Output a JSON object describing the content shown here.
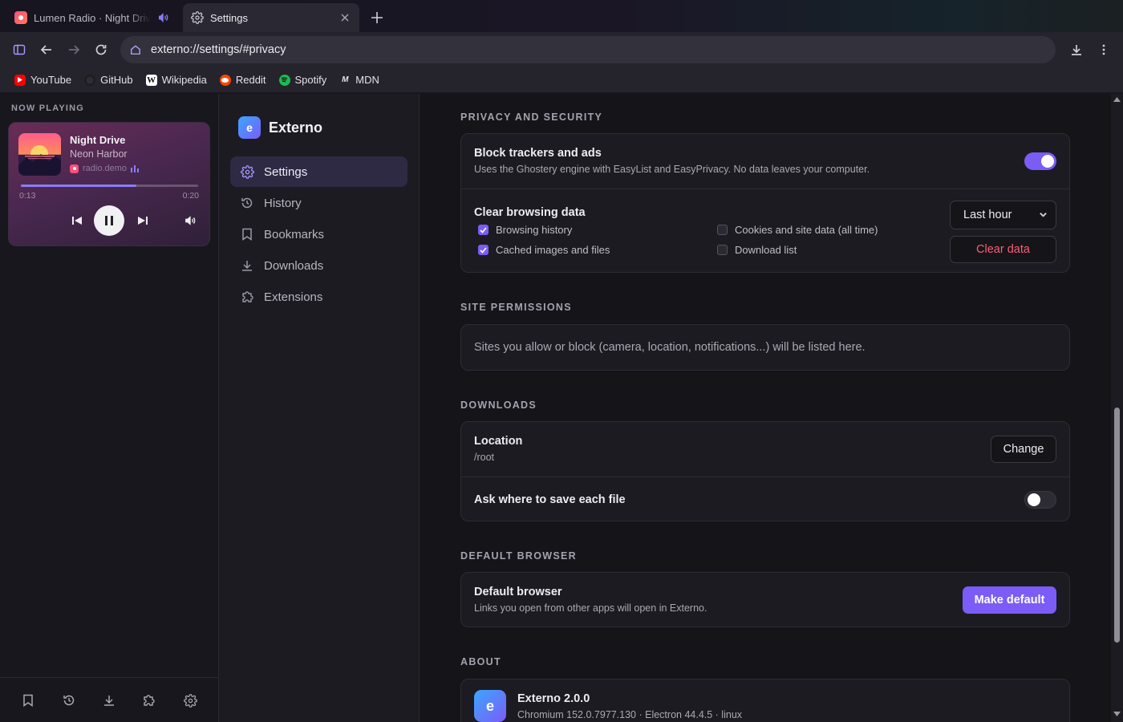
{
  "tabs": [
    {
      "title": "Lumen Radio · Night Drive",
      "audio": true,
      "favicon": "lumen-radio-icon"
    },
    {
      "title": "Settings",
      "active": true,
      "favicon": "gear-icon"
    }
  ],
  "toolbar": {
    "url": "externo://settings/#privacy"
  },
  "bookmarks": [
    {
      "label": "YouTube",
      "icon": "youtube-icon",
      "color": "#ff0000"
    },
    {
      "label": "GitHub",
      "icon": "github-icon",
      "color": "#24292e"
    },
    {
      "label": "Wikipedia",
      "icon": "wikipedia-icon",
      "color": "#ffffff"
    },
    {
      "label": "Reddit",
      "icon": "reddit-icon",
      "color": "#ff4500"
    },
    {
      "label": "Spotify",
      "icon": "spotify-icon",
      "color": "#1db954"
    },
    {
      "label": "MDN",
      "icon": "mdn-icon",
      "color": "#ffffff"
    }
  ],
  "now_playing": {
    "header": "NOW PLAYING",
    "title": "Night Drive",
    "artist": "Neon Harbor",
    "source": "radio.demo",
    "elapsed": "0:13",
    "duration": "0:20",
    "progress": 0.65
  },
  "settings_nav": {
    "brand": "Externo",
    "logo_letter": "e",
    "items": [
      {
        "label": "Settings",
        "icon": "gear-icon",
        "active": true
      },
      {
        "label": "History",
        "icon": "history-icon"
      },
      {
        "label": "Bookmarks",
        "icon": "bookmark-icon"
      },
      {
        "label": "Downloads",
        "icon": "download-icon"
      },
      {
        "label": "Extensions",
        "icon": "puzzle-icon"
      }
    ]
  },
  "privacy": {
    "section_title": "PRIVACY AND SECURITY",
    "block_trackers": {
      "title": "Block trackers and ads",
      "description": "Uses the Ghostery engine with EasyList and EasyPrivacy. No data leaves your computer.",
      "enabled": true
    },
    "clear_data": {
      "title": "Clear browsing data",
      "options": [
        {
          "label": "Browsing history",
          "checked": true
        },
        {
          "label": "Cached images and files",
          "checked": true
        },
        {
          "label": "Cookies and site data (all time)",
          "checked": false
        },
        {
          "label": "Download list",
          "checked": false
        }
      ],
      "range_selected": "Last hour",
      "button": "Clear data"
    }
  },
  "site_permissions": {
    "section_title": "SITE PERMISSIONS",
    "empty_text": "Sites you allow or block (camera, location, notifications...) will be listed here."
  },
  "downloads": {
    "section_title": "DOWNLOADS",
    "location_title": "Location",
    "location_value": "/root",
    "change_button": "Change",
    "ask_title": "Ask where to save each file",
    "ask_enabled": false
  },
  "default_browser": {
    "section_title": "DEFAULT BROWSER",
    "title": "Default browser",
    "description": "Links you open from other apps will open in Externo.",
    "button": "Make default"
  },
  "about": {
    "section_title": "ABOUT",
    "app_name": "Externo 2.0.0",
    "version_line": "Chromium 152.0.7977.130 · Electron 44.4.5 · linux",
    "logo_letter": "e"
  },
  "colors": {
    "accent": "#7b5cf6",
    "danger": "#ff5e73",
    "background": "#141419"
  }
}
